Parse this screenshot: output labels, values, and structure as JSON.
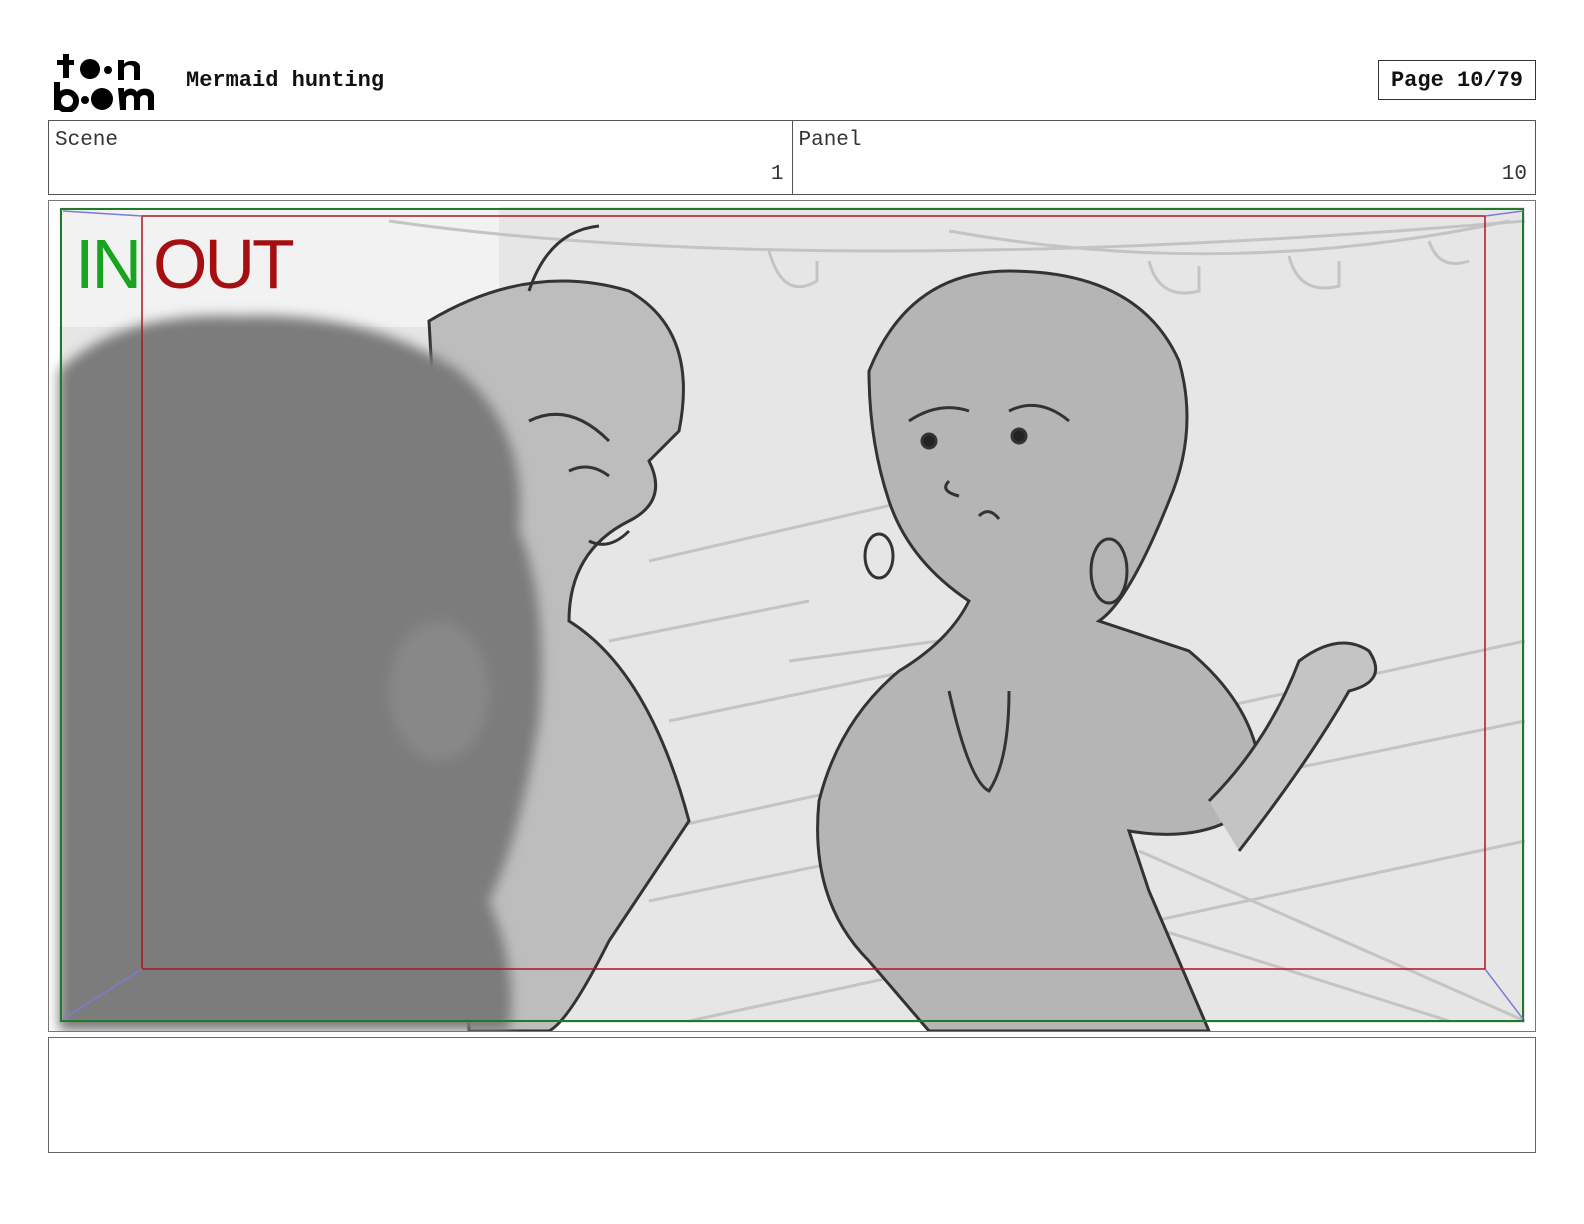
{
  "header": {
    "logo_text": "toon boom",
    "project_title": "Mermaid hunting",
    "page_indicator": "Page 10/79"
  },
  "info": {
    "scene_label": "Scene",
    "scene_value": "1",
    "panel_label": "Panel",
    "panel_value": "10"
  },
  "frame": {
    "in_label": "IN",
    "out_label": "OUT",
    "in_color": "#19a41f",
    "out_color": "#a50f0f"
  },
  "notes": {
    "text": ""
  }
}
